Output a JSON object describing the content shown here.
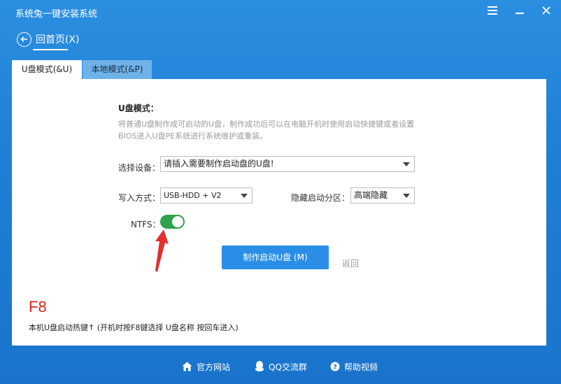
{
  "window": {
    "title": "系统兔一键安装系统",
    "menu_icon": "menu-icon",
    "minimize_icon": "minimize-icon",
    "close_icon": "close-icon"
  },
  "nav": {
    "back_label": "回首页(X)"
  },
  "tabs": [
    {
      "label": "U盘模式(&U)",
      "active": true
    },
    {
      "label": "本地模式(&P)",
      "active": false
    }
  ],
  "usb_mode": {
    "title": "U盘模式：",
    "description": "将普通U盘制作成可启动的U盘，制作成功后可以在电脑开机时使用启动快捷键或者设置BIOS进入U盘PE系统进行系统维护或重装。",
    "device": {
      "label": "选择设备：",
      "value": "请插入需要制作启动盘的U盘!"
    },
    "write_mode": {
      "label": "写入方式：",
      "value": "USB-HDD + V2"
    },
    "hidden_partition": {
      "label": "隐藏启动分区：",
      "value": "高端隐藏"
    },
    "ntfs": {
      "label": "NTFS：",
      "enabled": true
    },
    "make_button": "制作启动U盘 (M)",
    "return_link": "返回",
    "hotkey_title": "F8",
    "hotkey_desc": "本机U盘启动热键↑ (开机时按F8键选择 U盘名称 按回车进入)"
  },
  "footer": [
    {
      "label": "官方网站",
      "icon": "home-icon"
    },
    {
      "label": "QQ交流群",
      "icon": "qq-icon"
    },
    {
      "label": "帮助视频",
      "icon": "help-icon"
    }
  ],
  "colors": {
    "accent": "#2a8ee6",
    "toggle_on": "#2fa34a",
    "hotkey": "#e02020",
    "annotation_arrow": "#e03030"
  }
}
